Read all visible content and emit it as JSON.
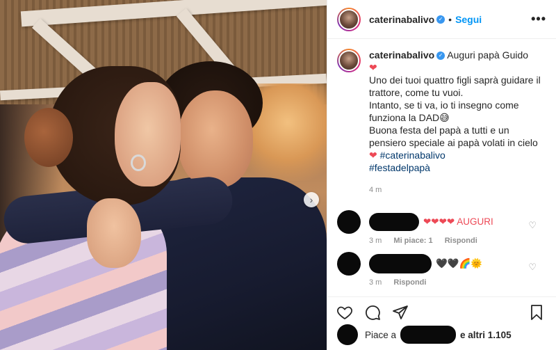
{
  "post": {
    "username": "caterinabalivo",
    "follow_label": "Segui",
    "dot": "•",
    "more_label": "•••"
  },
  "caption": {
    "username": "caterinabalivo",
    "line1": "Auguri papà Guido",
    "line2": "Uno dei tuoi quattro figli saprà guidare il trattore, come tu vuoi.",
    "line3": "Intanto, se ti va, io ti insegno come funziona la DAD😅",
    "line4": "Buona festa del papà a tutti e un pensiero speciale ai papà volati in cielo",
    "hashtag1": "#caterinabalivo",
    "hashtag2": "#festadelpapà",
    "time": "4 m"
  },
  "comments": [
    {
      "text": "❤❤❤❤ AUGURI",
      "time": "3 m",
      "likes": "Mi piace: 1",
      "reply": "Rispondi"
    },
    {
      "text": "🖤🖤🌈🌞",
      "time": "3 m",
      "reply": "Rispondi"
    }
  ],
  "likes": {
    "prefix": "Piace a",
    "suffix": "e altri 1.105"
  },
  "icons": {
    "heart": "heart-outline-icon",
    "comment": "comment-icon",
    "share": "paper-plane-icon",
    "bookmark": "bookmark-icon",
    "next": "chevron-right-icon"
  },
  "colors": {
    "follow": "#0095f6",
    "heart": "#ed4956",
    "hashtag": "#00376b",
    "meta": "#8e8e8e"
  }
}
